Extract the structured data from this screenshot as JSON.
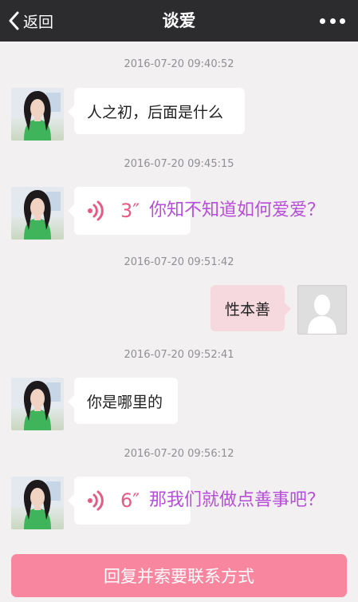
{
  "nav": {
    "back_label": "返回",
    "title": "谈爱",
    "back_icon": "chevron-left-icon",
    "more_icon": "more-dots-icon"
  },
  "messages": [
    {
      "timestamp": "2016-07-20 09:40:52",
      "from": "contact",
      "type": "text",
      "text": "人之初，后面是什么"
    },
    {
      "timestamp": "2016-07-20 09:45:15",
      "from": "contact",
      "type": "voice",
      "duration": "3″",
      "caption": "你知不知道如何爱爱？"
    },
    {
      "timestamp": "2016-07-20 09:51:42",
      "from": "me",
      "type": "text",
      "text": "性本善"
    },
    {
      "timestamp": "2016-07-20 09:52:41",
      "from": "contact",
      "type": "text",
      "text": "你是哪里的"
    },
    {
      "timestamp": "2016-07-20 09:56:12",
      "from": "contact",
      "type": "voice",
      "duration": "6″",
      "caption": "那我们就做点善事吧？"
    }
  ],
  "cta": {
    "label": "回复并索要联系方式"
  },
  "colors": {
    "nav_bg": "#2c2b2e",
    "chat_bg": "#f2f0f1",
    "my_bubble": "#f6d9df",
    "voice_accent": "#e65b83",
    "caption_purple": "#b84ddb",
    "cta_bg": "#f8869f"
  }
}
